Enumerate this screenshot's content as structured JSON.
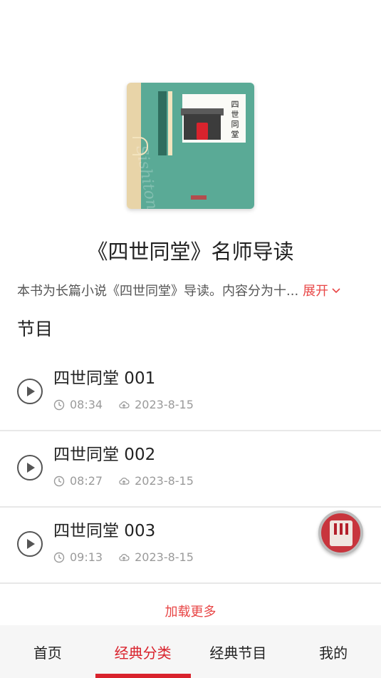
{
  "cover": {
    "title_vertical": "四世同堂",
    "decor_italic": "Sishitong"
  },
  "album": {
    "title": "《四世同堂》名师导读",
    "description": "本书为长篇小说《四世同堂》导读。内容分为十...",
    "expand_label": "展开"
  },
  "section": {
    "title": "节目"
  },
  "episodes": [
    {
      "title": "四世同堂 001",
      "duration": "08:34",
      "date": "2023-8-15"
    },
    {
      "title": "四世同堂 002",
      "duration": "08:27",
      "date": "2023-8-15"
    },
    {
      "title": "四世同堂 003",
      "duration": "09:13",
      "date": "2023-8-15"
    }
  ],
  "load_more": "加载更多",
  "tabs": [
    {
      "label": "首页"
    },
    {
      "label": "经典分类"
    },
    {
      "label": "经典节目"
    },
    {
      "label": "我的"
    }
  ],
  "active_tab_index": 1,
  "colors": {
    "accent": "#d9232d",
    "link": "#e84646",
    "cover_green": "#5aaa96",
    "muted_text": "#9a9a9a"
  }
}
